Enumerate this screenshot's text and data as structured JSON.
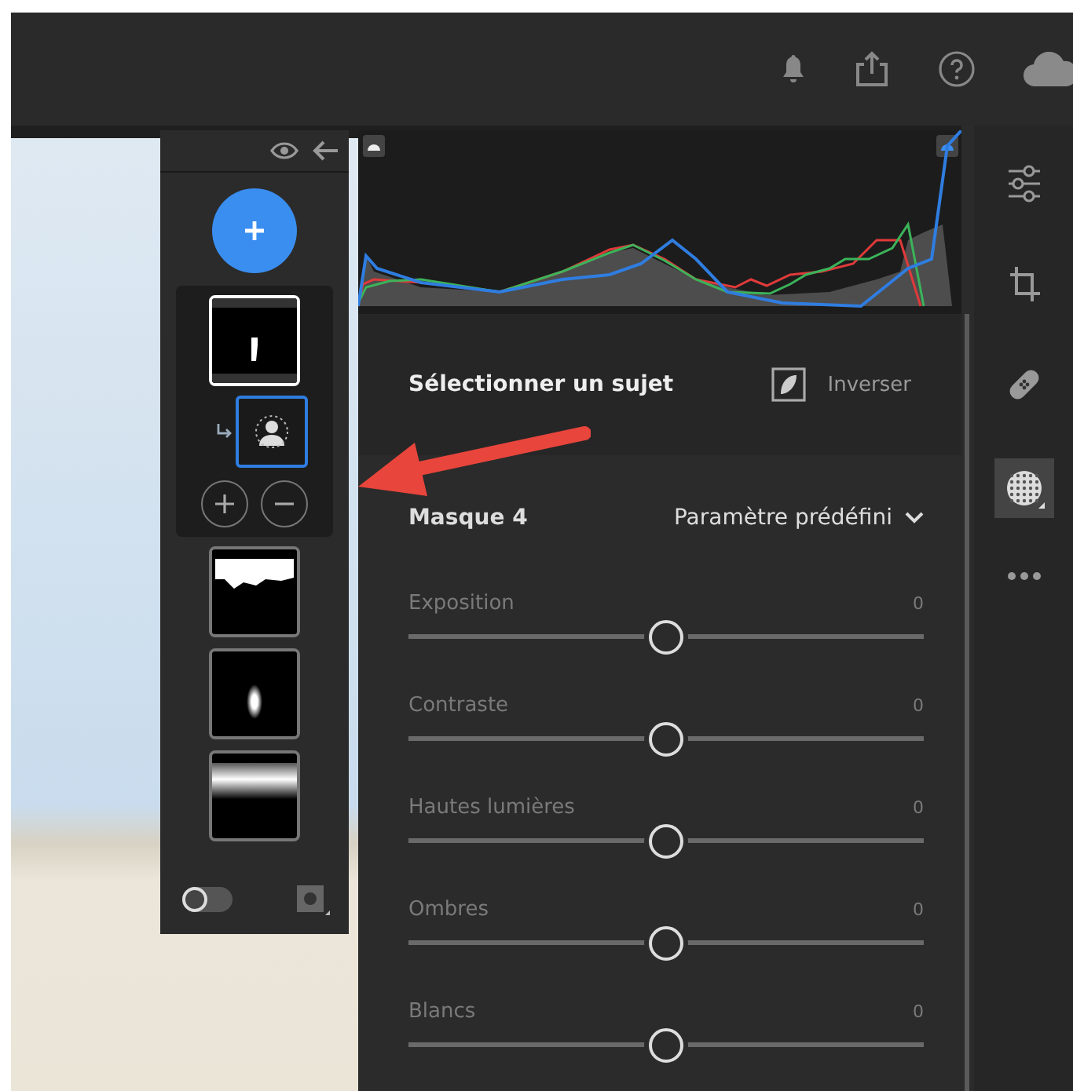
{
  "mask_panel": {
    "masks": [
      {
        "kind": "subject",
        "selected": true,
        "components": [
          {
            "kind": "select-subject",
            "selected": true
          }
        ]
      },
      {
        "kind": "sky",
        "selected": false
      },
      {
        "kind": "radial",
        "selected": false
      },
      {
        "kind": "linear",
        "selected": false
      }
    ],
    "overlay_on": false
  },
  "subject_section": {
    "title": "Sélectionner un sujet",
    "invert_label": "Inverser"
  },
  "mask_header": {
    "title": "Masque 4",
    "preset": "Paramètre prédéfini"
  },
  "sliders": [
    {
      "name": "Exposition",
      "reading": "0",
      "level": 0.5
    },
    {
      "name": "Contraste",
      "reading": "0",
      "level": 0.5
    },
    {
      "name": "Hautes lumières",
      "reading": "0",
      "level": 0.5
    },
    {
      "name": "Ombres",
      "reading": "0",
      "level": 0.5
    },
    {
      "name": "Blancs",
      "reading": "0",
      "level": 0.5
    }
  ],
  "tools": [
    {
      "kind": "edit",
      "selected": false
    },
    {
      "kind": "crop",
      "selected": false
    },
    {
      "kind": "heal",
      "selected": false
    },
    {
      "kind": "mask",
      "selected": true
    },
    {
      "kind": "more",
      "selected": false
    }
  ]
}
